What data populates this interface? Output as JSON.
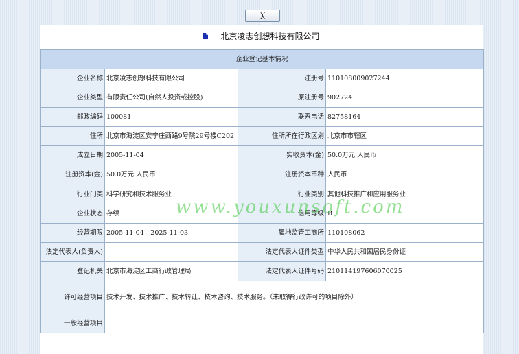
{
  "close_button": "关 闭",
  "company_title": "北京凌志创想科技有限公司",
  "table_header": "企业登记基本情况",
  "rows": [
    {
      "l1": "企业名称",
      "v1": "北京凌志创想科技有限公司",
      "l2": "注册号",
      "v2": "110108009027244"
    },
    {
      "l1": "企业类型",
      "v1": "有限责任公司(自然人投资或控股)",
      "l2": "原注册号",
      "v2": "902724"
    },
    {
      "l1": "邮政编码",
      "v1": "100081",
      "l2": "联系电话",
      "v2": "82758164"
    },
    {
      "l1": "住所",
      "v1": "北京市海淀区安宁庄西路9号院29号楼C202",
      "l2": "住所所在行政区划",
      "v2": "北京市市辖区"
    },
    {
      "l1": "成立日期",
      "v1": "2005-11-04",
      "l2": "实收资本(金)",
      "v2": "50.0万元 人民币"
    },
    {
      "l1": "注册资本(金)",
      "v1": "50.0万元 人民币",
      "l2": "注册资本币种",
      "v2": "人民币"
    },
    {
      "l1": "行业门类",
      "v1": "科学研究和技术服务业",
      "l2": "行业类别",
      "v2": "其他科技推广和应用服务业"
    },
    {
      "l1": "企业状态",
      "v1": "存续",
      "l2": "信用等级",
      "v2": "B"
    },
    {
      "l1": "经营期限",
      "v1": "2005-11-04—2025-11-03",
      "l2": "属地监管工商所",
      "v2": "110108062"
    },
    {
      "l1": "法定代表人(负责人)",
      "v1": "",
      "l2": "法定代表人证件类型",
      "v2": "中华人民共和国居民身份证"
    },
    {
      "l1": "登记机关",
      "v1": "北京市海淀区工商行政管理局",
      "l2": "法定代表人证件号码",
      "v2": "210114197606070025"
    }
  ],
  "license_label": "许可经营项目",
  "license_value": "技术开发、技术推广、技术转让、技术咨询、技术服务。（未取得行政许可的项目除外）",
  "general_label": "一般经营项目",
  "general_value": "",
  "watermark": "www.youxunsoft.com"
}
